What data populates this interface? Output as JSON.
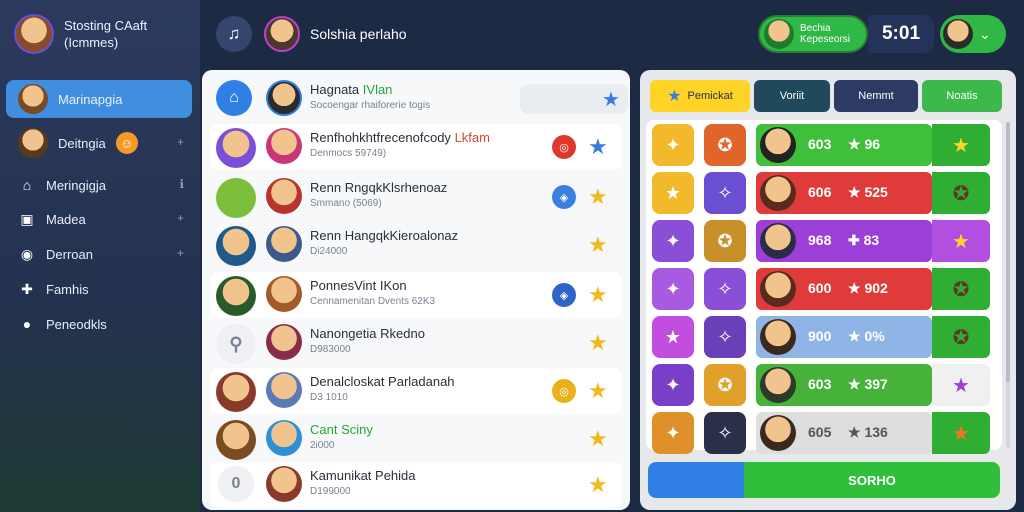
{
  "profile": {
    "name": "Stosting CAaft",
    "subtitle": "(Icmmes)"
  },
  "sidebar": {
    "items": [
      {
        "label": "Marinapgia",
        "icon": "avatar",
        "active": true
      },
      {
        "label": "Deitngia",
        "icon": "avatar",
        "badge": "smile-icon"
      },
      {
        "label": "Meringigja",
        "icon": "home-icon"
      },
      {
        "label": "Madea",
        "icon": "tv-icon"
      },
      {
        "label": "Derroan",
        "icon": "circle-icon"
      },
      {
        "label": "Famhis",
        "icon": "gamepad-icon"
      },
      {
        "label": "Peneodkls",
        "icon": "record-icon"
      }
    ]
  },
  "header": {
    "user_name": "Solshia perlaho",
    "coin_line1": "Bechia",
    "coin_line2": "Kepeseorsi",
    "timer": "5:01"
  },
  "list": {
    "rows": [
      {
        "title": "Hagnata",
        "title_hl": "IVlan",
        "subtitle": "Socoengar rhaiforerie togis",
        "star": "blue"
      },
      {
        "title": "Renfhohkhtfrecenofcody",
        "title_hl": "Lkfam",
        "subtitle": "Denmocs 59749)",
        "tag": "red",
        "star": "blue"
      },
      {
        "title": "Renn RngqkKlsrhenoaz",
        "subtitle": "Smmano (5069)",
        "tag": "blue",
        "star": "gold"
      },
      {
        "title": "Renn HangqkKieroalonaz",
        "subtitle": "Di24000",
        "star": "gold"
      },
      {
        "title": "PonnesVint IKon",
        "subtitle": "Cennamenitan Dvents",
        "subtitle2": "62K3",
        "tag": "blue",
        "star": "gold"
      },
      {
        "title": "Nanongetia Rkedno",
        "subtitle": "D983000",
        "star": "gold"
      },
      {
        "title": "Denalcloskat Parladanah",
        "subtitle": "D3 1010",
        "tag": "gold",
        "star": "gold"
      },
      {
        "title": "Cant Sciny",
        "subtitle": "2i000",
        "star": "gold"
      },
      {
        "title": "Kamunikat Pehida",
        "subtitle": "D199000",
        "star": "gold"
      }
    ]
  },
  "right": {
    "tabs": [
      "Pemickat",
      "Voriit",
      "Nemmt",
      "Noatis"
    ],
    "rows": [
      {
        "score": "603",
        "value": "96",
        "color": "#3fbf3a",
        "end": "#2fae33"
      },
      {
        "score": "606",
        "value": "525",
        "color": "#e03b3b",
        "end": "#2fae33"
      },
      {
        "score": "968",
        "value": "83",
        "color": "#9c3fd6",
        "end": "#b24ee0"
      },
      {
        "score": "600",
        "value": "902",
        "color": "#e03b3b",
        "end": "#2fae33"
      },
      {
        "score": "900",
        "value": "0%",
        "color": "#8fb4e6",
        "end": "#2fae33"
      },
      {
        "score": "603",
        "value": "397",
        "color": "#46b23a",
        "end": "#f0f0f0"
      },
      {
        "score": "605",
        "value": "136",
        "color": "#dedede",
        "end": "#2fae33"
      }
    ],
    "cta": "SORHO"
  }
}
